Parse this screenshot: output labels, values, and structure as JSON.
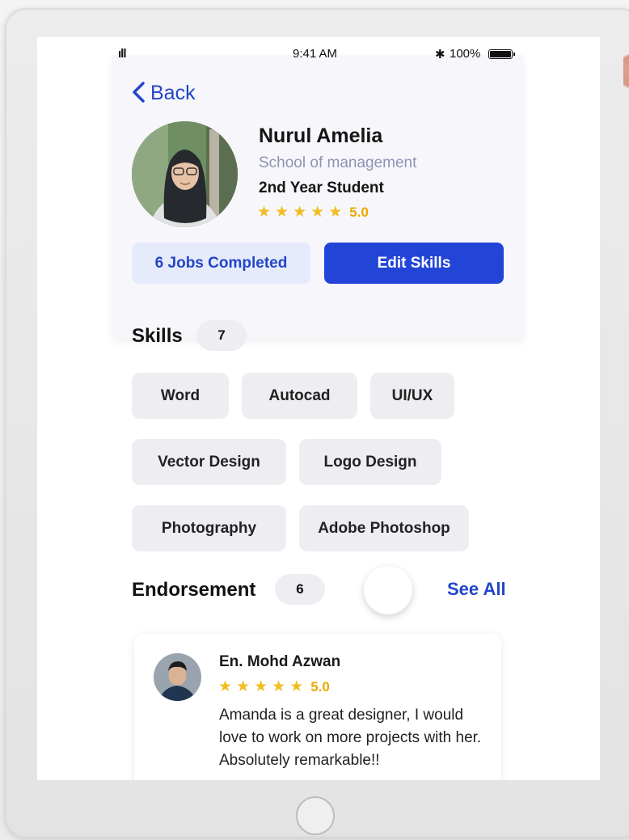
{
  "status_bar": {
    "signal": "ıll",
    "time": "9:41 AM",
    "bluetooth": "✱",
    "battery": "100%"
  },
  "nav": {
    "back_icon": "chevron-left-icon",
    "back_label": "Back"
  },
  "profile": {
    "name": "Nurul Amelia",
    "school": "School of management",
    "year": "2nd Year Student",
    "stars": 5,
    "rating": "5.0",
    "jobs_completed_label": "6 Jobs Completed",
    "edit_skills_label": "Edit Skills"
  },
  "skills": {
    "title": "Skills",
    "count": "7",
    "items": [
      "Word",
      "Autocad",
      "UI/UX",
      "Vector Design",
      "Logo Design",
      "Photography",
      "Adobe Photoshop"
    ]
  },
  "endorsement": {
    "title": "Endorsement",
    "count": "6",
    "see_all_label": "See All",
    "card": {
      "name": "En. Mohd Azwan",
      "stars": 5,
      "rating": "5.0",
      "text": "Amanda is a great designer, I would love to work on more projects with her. Absolutely remarkable!!"
    }
  },
  "colors": {
    "accent": "#2345d7",
    "accent_text": "#2345c9",
    "star": "#f2bd22",
    "chip_bg": "#ededf2",
    "secondary_text": "#8e93b1"
  }
}
